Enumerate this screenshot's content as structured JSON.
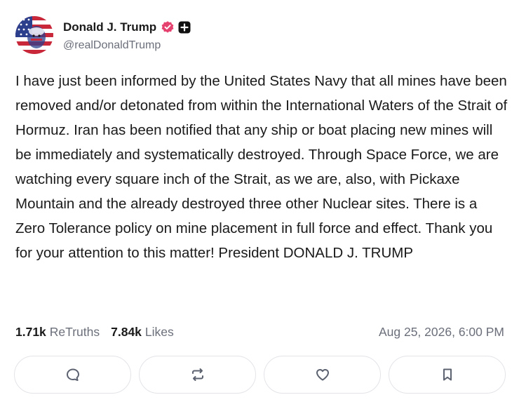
{
  "author": {
    "display_name": "Donald J. Trump",
    "handle": "@realDonaldTrump",
    "avatar_icon": "flag-portrait-avatar",
    "verified_icon": "verified-badge-icon",
    "verified_color": "#e5426f",
    "plus_icon": "plus-badge-icon"
  },
  "post": {
    "text": "I have just been informed by the United States Navy that all mines have been removed and/or detonated from within the International Waters of the Strait of Hormuz. Iran has been notified that any ship or boat placing new mines will be immediately and systematically destroyed. Through Space Force, we are watching every square inch of the Strait, as we are, also, with Pickaxe Mountain and the already destroyed three other Nuclear sites. There is a Zero Tolerance policy on mine placement in full force and effect. Thank you for your attention to this matter! President DONALD J. TRUMP"
  },
  "stats": {
    "retruths_count": "1.71k",
    "retruths_label": "ReTruths",
    "likes_count": "7.84k",
    "likes_label": "Likes",
    "timestamp": "Aug 25, 2026, 6:00 PM"
  },
  "actions": [
    {
      "icon": "reply-icon"
    },
    {
      "icon": "retruth-icon"
    },
    {
      "icon": "heart-icon"
    },
    {
      "icon": "bookmark-icon"
    }
  ]
}
